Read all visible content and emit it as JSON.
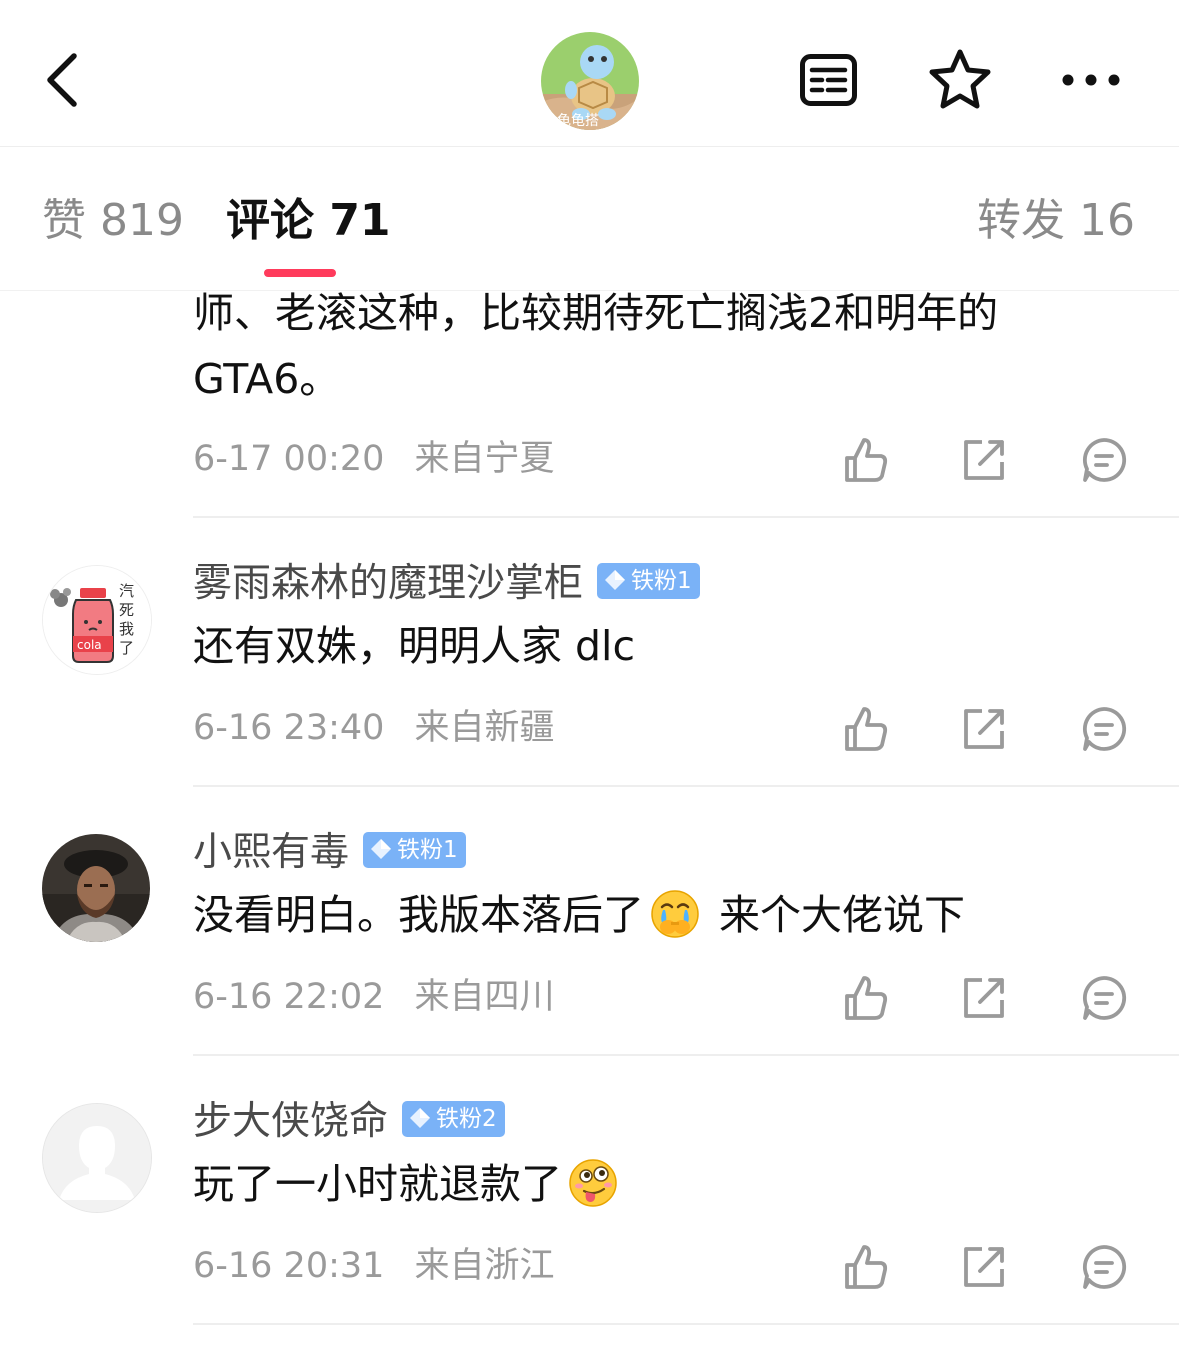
{
  "header": {
    "back_icon": "chevron-left-icon",
    "avatar_text": "龟龟搭",
    "icons": [
      "list-icon",
      "star-icon",
      "more-icon"
    ]
  },
  "tabs": [
    {
      "label": "赞 819"
    },
    {
      "label": "评论 71"
    },
    {
      "label": "转发 16"
    }
  ],
  "comments": [
    {
      "text_lines": [
        "师、老滚这种，比较期待死亡搁浅2和明年的",
        "GTA6。"
      ],
      "time": "6-17 00:20",
      "location": "来自宁夏"
    },
    {
      "username": "雾雨森林的魔理沙掌柜",
      "badge": "铁粉1",
      "avatar_text": [
        "汽",
        "死",
        "我",
        "了"
      ],
      "cola_text": "cola",
      "text": "还有双姝，明明人家 dlc",
      "time": "6-16 23:40",
      "location": "来自新疆"
    },
    {
      "username": "小熙有毒",
      "badge": "铁粉1",
      "text_before": "没看明白。我版本落后了",
      "text_after": " 来个大佬说下",
      "emoji": "crying-covering-mouth-emoji",
      "time": "6-16 22:02",
      "location": "来自四川"
    },
    {
      "username": "步大侠饶命",
      "badge": "铁粉2",
      "text": "玩了一小时就退款了",
      "emoji": "tongue-out-emoji",
      "time": "6-16 20:31",
      "location": "来自浙江"
    }
  ],
  "colors": {
    "accent": "#ff3b5c",
    "badge": "#7ab2f7",
    "muted_text": "#9a9a9a"
  }
}
